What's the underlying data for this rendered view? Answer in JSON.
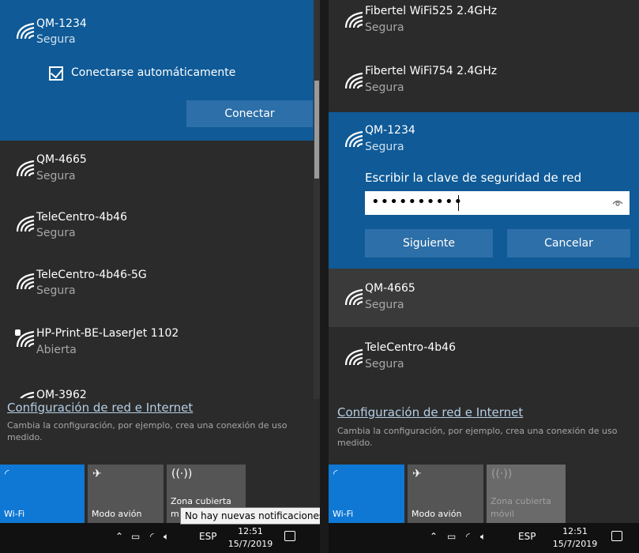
{
  "left": {
    "expanded_network": {
      "name": "QM-1234",
      "status": "Segura",
      "auto_connect_label": "Conectarse automáticamente",
      "auto_connect_checked": true,
      "connect_button": "Conectar"
    },
    "networks": [
      {
        "name": "QM-4665",
        "status": "Segura"
      },
      {
        "name": "TeleCentro-4b46",
        "status": "Segura"
      },
      {
        "name": "TeleCentro-4b46-5G",
        "status": "Segura"
      },
      {
        "name": "HP-Print-BE-LaserJet 1102",
        "status": "Abierta"
      },
      {
        "name": "QM-3962",
        "status": ""
      }
    ],
    "settings": {
      "link": "Configuración de red e Internet",
      "description": "Cambia la configuración, por ejemplo, crea una conexión de uso medido."
    },
    "tiles": [
      {
        "label": "Wi-Fi",
        "icon": "wifi-icon",
        "state": "on"
      },
      {
        "label": "Modo avión",
        "icon": "airplane-icon",
        "state": "off"
      },
      {
        "label": "Zona cubierta",
        "label2": "m",
        "icon": "hotspot-icon",
        "state": "off"
      }
    ],
    "taskbar": {
      "lang": "ESP",
      "time": "12:51",
      "date": "15/7/2019"
    },
    "tooltip": "No hay nuevas notificaciones"
  },
  "right": {
    "networks_top": [
      {
        "name": "Fibertel WiFi525 2.4GHz",
        "status": "Segura"
      },
      {
        "name": "Fibertel WiFi754 2.4GHz",
        "status": "Segura"
      }
    ],
    "expanded_network": {
      "name": "QM-1234",
      "status": "Segura",
      "prompt": "Escribir la clave de seguridad de red",
      "password_mask": "••••••••••",
      "next_button": "Siguiente",
      "cancel_button": "Cancelar"
    },
    "networks": [
      {
        "name": "QM-4665",
        "status": "Segura"
      },
      {
        "name": "TeleCentro-4b46",
        "status": "Segura"
      }
    ],
    "settings": {
      "link": "Configuración de red e Internet",
      "description": "Cambia la configuración, por ejemplo, crea una conexión de uso medido."
    },
    "tiles": [
      {
        "label": "Wi-Fi",
        "icon": "wifi-icon",
        "state": "on"
      },
      {
        "label": "Modo avión",
        "icon": "airplane-icon",
        "state": "off"
      },
      {
        "label": "Zona cubierta",
        "label2": "móvil",
        "icon": "hotspot-icon",
        "state": "dim"
      }
    ],
    "taskbar": {
      "lang": "ESP",
      "time": "12:51",
      "date": "15/7/2019"
    }
  },
  "colors": {
    "accent": "#0f78d4",
    "expanded_bg": "#0f5a97",
    "panel_bg": "#2b2b2b"
  }
}
